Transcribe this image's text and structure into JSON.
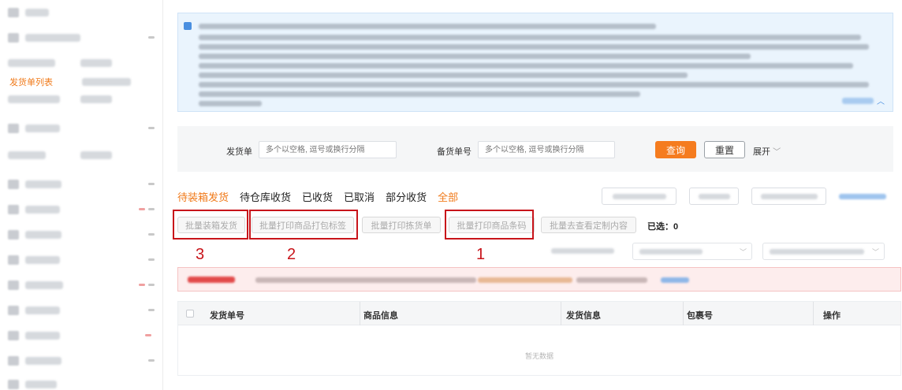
{
  "sidebar": {
    "active_item": "发货单列表"
  },
  "filter": {
    "shipment_label": "发货单",
    "shipment_placeholder": "多个以空格, 逗号或换行分隔",
    "stock_label": "备货单号",
    "stock_placeholder": "多个以空格, 逗号或换行分隔",
    "query_label": "查询",
    "reset_label": "重置",
    "expand_label": "展开",
    "expand_icon": "chevron-down-icon"
  },
  "tabs": [
    {
      "label": "待装箱发货",
      "active": true
    },
    {
      "label": "待仓库收货"
    },
    {
      "label": "已收货"
    },
    {
      "label": "已取消"
    },
    {
      "label": "部分收货"
    },
    {
      "label": "全部"
    }
  ],
  "batch_buttons": {
    "pack_ship": "批量装箱发货",
    "print_pack_label": "批量打印商品打包标签",
    "print_pick_list": "批量打印拣货单",
    "print_barcode": "批量打印商品条码",
    "view_custom": "批量去查看定制内容"
  },
  "selected": {
    "label": "已选：",
    "count": "0"
  },
  "annotations": {
    "barcode_number": "1",
    "pack_label_number": "2",
    "pack_ship_number": "3",
    "color": "#c8141a"
  },
  "table": {
    "columns": [
      "发货单号",
      "商品信息",
      "发货信息",
      "包裹号",
      "操作"
    ],
    "empty_text": "暂无数据"
  },
  "colors": {
    "accent": "#f57c1f",
    "notice_bg": "#eaf4fd",
    "alert_bg": "#fdeded"
  }
}
